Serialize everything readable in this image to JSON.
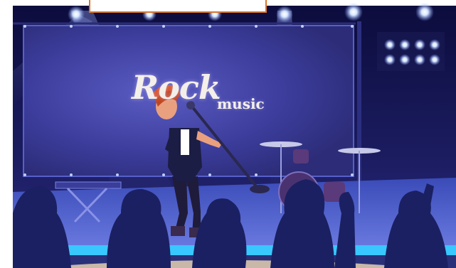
{
  "poster": {
    "title_main": "Rock",
    "title_sub": "music"
  },
  "colors": {
    "sky_top": "#12124a",
    "screen": "#3a3b95",
    "stage_floor": "#39c7ff",
    "silhouette": "#1b2062",
    "singer_hair": "#c2471f",
    "accent_border": "#d9772b"
  },
  "icons": [
    "spotlight-icon",
    "microphone-icon",
    "cymbal-icon",
    "drum-icon",
    "keyboard-icon"
  ]
}
